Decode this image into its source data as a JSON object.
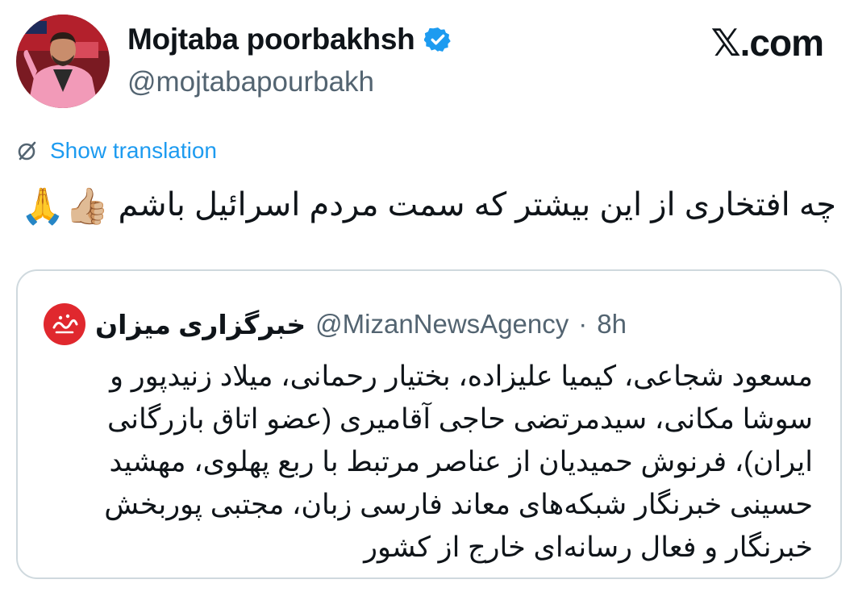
{
  "author": {
    "display_name": "Mojtaba poorbakhsh",
    "handle": "@mojtabapourbakh",
    "verified": true,
    "avatar_icon": "profile-photo"
  },
  "brand": "𝕏.com",
  "translation": {
    "label": "Show translation",
    "icon": "translate-icon"
  },
  "tweet": {
    "text": "چه افتخاری از این بیشتر که سمت مردم اسرائیل باشم",
    "emojis": "👍🏼🙏"
  },
  "quote": {
    "display_name": "خبرگزاری میزان",
    "handle": "@MizanNewsAgency",
    "separator": "·",
    "time": "8h",
    "logo_icon": "mizan-logo",
    "lines": [
      "مسعود شجاعی، کیمیا علیزاده، بختیار رحمانی، میلاد زنیدپور و",
      "سوشا مکانی، سیدمرتضی حاجی آقامیری (عضو اتاق بازرگانی",
      "ایران)، فرنوش حمیدیان از عناصر مرتبط با ربع پهلوی، مهشید",
      "حسینی خبرنگار  شبکه‌های معاند فارسی زبان، مجتبی پوربخش",
      "خبرنگار و فعال رسانه‌ای خارج از  کشور"
    ]
  },
  "colors": {
    "link": "#1d9bf0",
    "secondary_text": "#536471",
    "border": "#cfd9de",
    "verified_badge": "#1d9bf0",
    "mizan_red": "#e0282e"
  }
}
